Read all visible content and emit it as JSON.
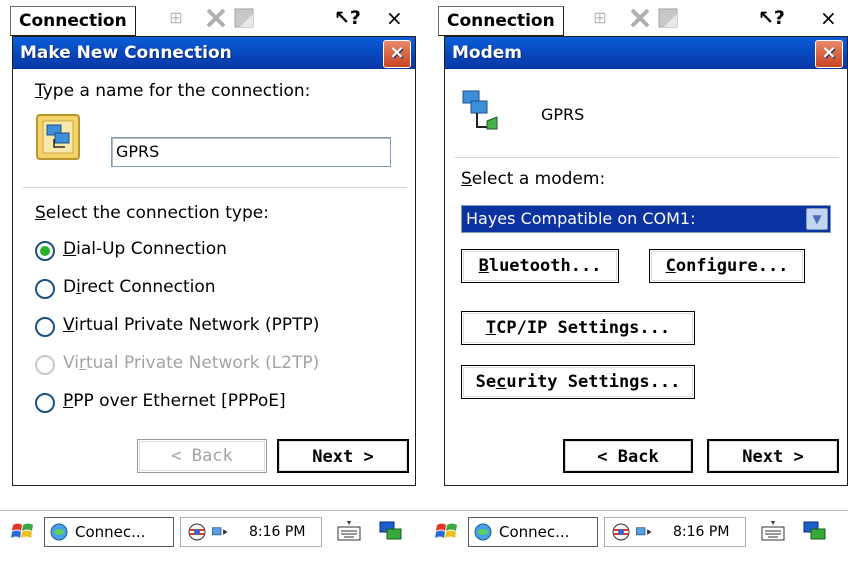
{
  "left": {
    "topbar": {
      "menu_label": "Connection",
      "help_glyph": "?",
      "close_glyph": "×"
    },
    "dialog": {
      "title": "Make New Connection",
      "close_glyph": "×",
      "name_prompt": "Type a name for the connection:",
      "name_prompt_hotkey": "T",
      "name_value": "GPRS",
      "type_prompt": "Select the connection type:",
      "type_prompt_hotkey": "S",
      "options": [
        {
          "hotkey": "D",
          "label": "ial-Up Connection",
          "checked": true,
          "disabled": false
        },
        {
          "pre": "D",
          "hotkey": "i",
          "label": "rect Connection",
          "checked": false,
          "disabled": false
        },
        {
          "hotkey": "V",
          "label": "irtual Private Network (PPTP)",
          "checked": false,
          "disabled": false
        },
        {
          "pre": "Vi",
          "hotkey": "r",
          "label": "tual Private Network (L2TP)",
          "checked": false,
          "disabled": true
        },
        {
          "hotkey": "P",
          "label": "PP over Ethernet [PPPoE]",
          "checked": false,
          "disabled": false
        }
      ],
      "back_label": "< Back",
      "next_label": "Next >"
    },
    "taskbar": {
      "task_label": "Connec...",
      "clock": "8:16 PM"
    }
  },
  "right": {
    "topbar": {
      "menu_label": "Connection",
      "help_glyph": "?",
      "close_glyph": "×"
    },
    "dialog": {
      "title": "Modem",
      "close_glyph": "×",
      "connection_name": "GPRS",
      "modem_prompt": "Select a modem:",
      "modem_value": "Hayes Compatible on COM1:",
      "bluetooth_label": "Bluetooth...",
      "configure_label": "Configure...",
      "tcpip_label": "TCP/IP Settings...",
      "security_label": "Security Settings...",
      "back_label": "< Back",
      "next_label": "Next >"
    },
    "taskbar": {
      "task_label": "Connec...",
      "clock": "8:16 PM"
    }
  },
  "colors": {
    "titlebar": "#0844b8",
    "selection": "#0a32a0",
    "radio_checked": "#29b12b",
    "close_button": "#c9431f"
  },
  "icons": {
    "start": "windows-flag-icon",
    "task": "connection-globe-icon",
    "tray": [
      "network-icon",
      "connection-status-icon"
    ],
    "keyboard": "keyboard-icon",
    "switcher": "task-switch-icon",
    "dialog_wizard": "network-wizard-icon",
    "dialog_modem": "modem-phone-icon"
  }
}
